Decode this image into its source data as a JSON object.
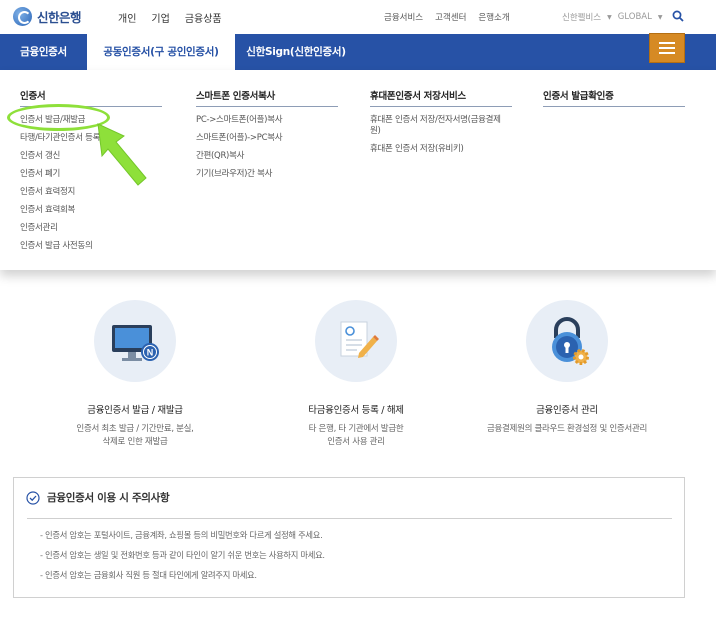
{
  "header": {
    "logo_text": "신한은행",
    "nav_left": [
      "개인",
      "기업",
      "금융상품"
    ],
    "nav_right": [
      "금융서비스",
      "고객센터",
      "은행소개"
    ],
    "family_label": "신한펠비스",
    "global_label": "GLOBAL"
  },
  "tabs": {
    "items": [
      "금융인증서",
      "공동인증서(구 공인인증서)",
      "신한Sign(신한인증서)"
    ],
    "active_index": 1
  },
  "menu": {
    "columns": [
      {
        "title": "인증서",
        "items": [
          "인증서 발급/재발급",
          "타행/타기관인증서 등록/해제",
          "인증서 갱신",
          "인증서 폐기",
          "인증서 효력정지",
          "인증서 효력회복",
          "인증서관리",
          "인증서 발급 사전동의"
        ]
      },
      {
        "title": "스마트폰 인증서복사",
        "items": [
          "PC->스마트폰(어플)복사",
          "스마트폰(어플)->PC복사",
          "간편(QR)복사",
          "기기(브라우저)간 복사"
        ]
      },
      {
        "title": "휴대폰인증서 저장서비스",
        "items": [
          "휴대폰 인증서 저장/전자서명(금융결제원)",
          "휴대폰 인증서 저장(유비키)"
        ]
      },
      {
        "title": "인증서 발급확인증",
        "items": []
      }
    ]
  },
  "features": [
    {
      "title": "금융인증서 발급 / 재발급",
      "desc1": "인증서 최초 발급 / 기간만료, 분실,",
      "desc2": "삭제로 인한 재발급"
    },
    {
      "title": "타금융인증서 등록 / 해제",
      "desc1": "타 은행, 타 기관에서 발급한",
      "desc2": "인증서 사용 관리"
    },
    {
      "title": "금융인증서 관리",
      "desc1": "금융결제원의 클라우드 환경설정 및 인증서관리",
      "desc2": ""
    }
  ],
  "notice": {
    "title": "금융인증서 이용 시 주의사항",
    "items": [
      "인증서 암호는 포털사이트, 금융계좌, 쇼핑몰 등의 비밀번호와 다르게 설정해 주세요.",
      "인증서 암호는 생일 및 전화번호 등과 같이 타인이 알기 쉬운 번호는 사용하지 마세요.",
      "인증서 암호는 금융회사 직원 등 절대 타인에게 알려주지 마세요."
    ]
  },
  "colors": {
    "tab_bar": "#2752a6",
    "menu_button": "#d68a24",
    "highlight": "#8ee03a"
  }
}
